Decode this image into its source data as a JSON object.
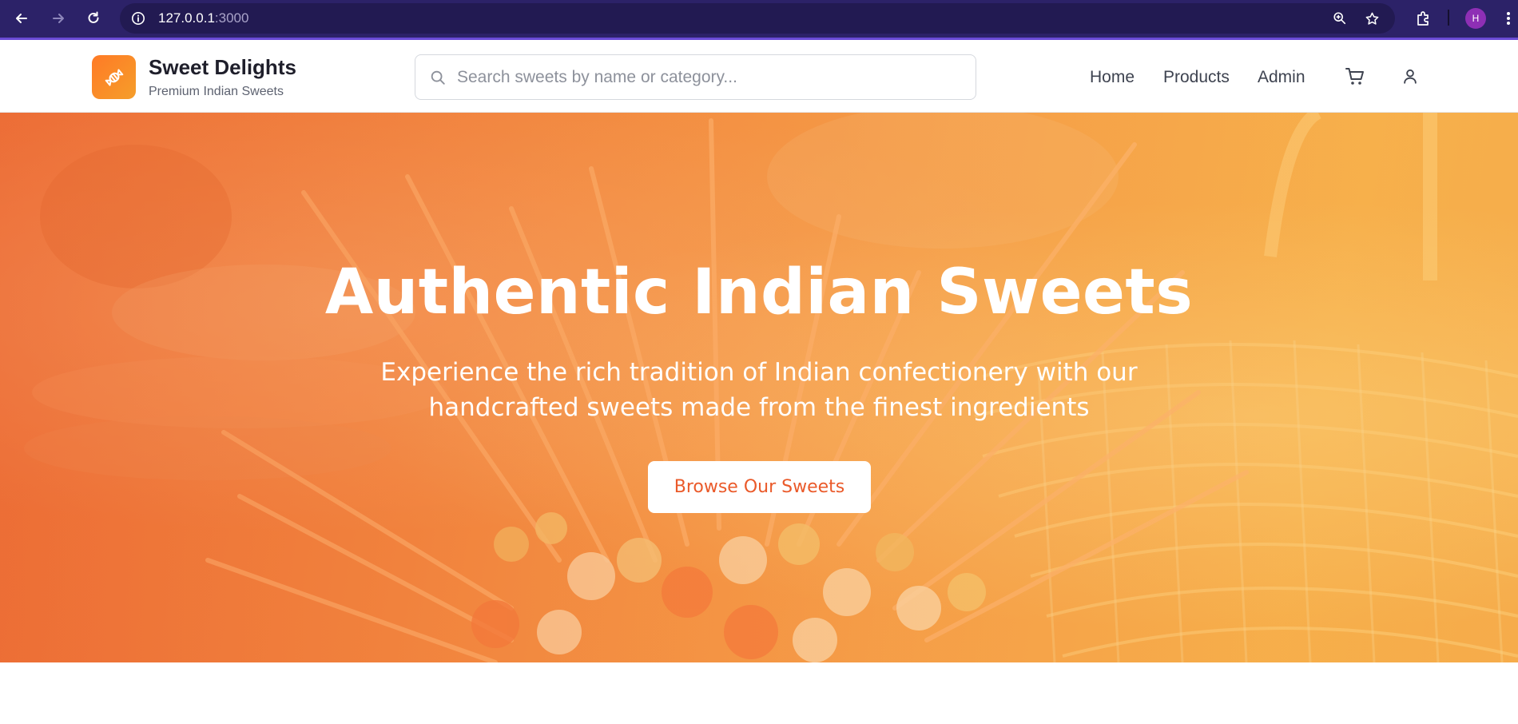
{
  "browser": {
    "url_host": "127.0.0.1",
    "url_port": ":3000",
    "profile_initial": "H",
    "icons": [
      "back-icon",
      "forward-icon",
      "reload-icon",
      "site-info-icon",
      "zoom-icon",
      "star-icon",
      "extensions-icon",
      "menu-icon"
    ]
  },
  "header": {
    "brand_name": "Sweet Delights",
    "brand_tagline": "Premium Indian Sweets",
    "search_placeholder": "Search sweets by name or category...",
    "nav": {
      "home": "Home",
      "products": "Products",
      "admin": "Admin"
    },
    "icons": [
      "candy-icon",
      "search-icon",
      "cart-icon",
      "user-icon"
    ]
  },
  "hero": {
    "title": "Authentic Indian Sweets",
    "subtitle": "Experience the rich tradition of Indian confectionery with our handcrafted sweets made from the finest ingredients",
    "cta_label": "Browse Our Sweets"
  },
  "colors": {
    "browser_bar": "#2c2268",
    "brand_orange": "#ff7a26",
    "cta_text": "#ea5a2a"
  }
}
